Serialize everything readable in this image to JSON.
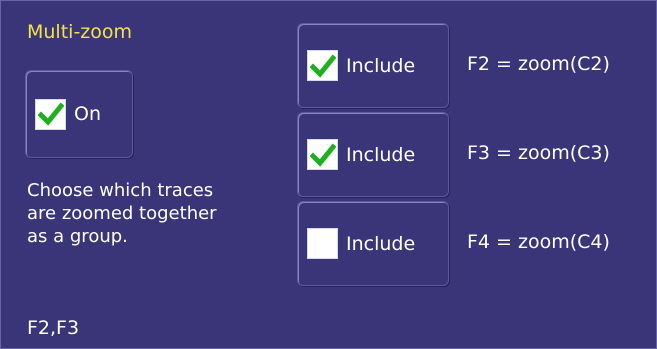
{
  "panel": {
    "title": "Multi-zoom",
    "on_toggle": {
      "label": "On",
      "checked": true
    },
    "description_lines": [
      "Choose which traces",
      "are zoomed together",
      "as a group."
    ],
    "footer": "F2,F3"
  },
  "traces": [
    {
      "include_label": "Include",
      "checked": true,
      "expression": "F2 = zoom(C2)"
    },
    {
      "include_label": "Include",
      "checked": true,
      "expression": "F3 = zoom(C3)"
    },
    {
      "include_label": "Include",
      "checked": false,
      "expression": "F4 = zoom(C4)"
    }
  ],
  "colors": {
    "background": "#3a3478",
    "title": "#f2e34a",
    "text": "#ffffff",
    "checkmark": "#1fb01f"
  },
  "icons": {
    "checkmark": "checkmark-icon"
  }
}
